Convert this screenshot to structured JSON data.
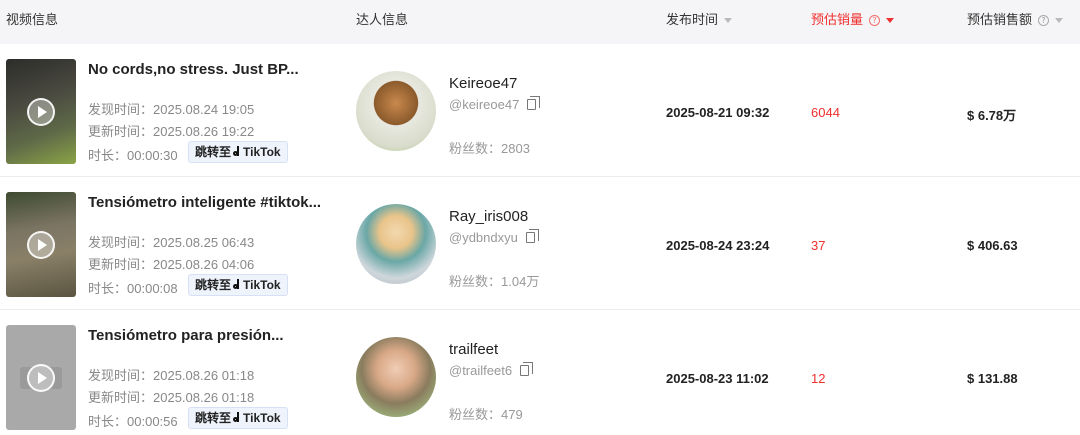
{
  "header": {
    "video_info": "视频信息",
    "influencer_info": "达人信息",
    "publish_time": "发布时间",
    "est_sales": "预估销量",
    "est_revenue": "预估销售额",
    "help_glyph": "?"
  },
  "labels": {
    "discovered": "发现时间：",
    "updated": "更新时间：",
    "duration": "时长：",
    "jump_to": "跳转至",
    "tiktok": "TikTok",
    "fans": "粉丝数："
  },
  "rows": [
    {
      "title": "No cords,no stress. Just BP...",
      "discovered": "2025.08.24 19:05",
      "updated": "2025.08.26 19:22",
      "duration": "00:00:30",
      "name": "Keireoe47",
      "handle": "@keireoe47",
      "fans": "2803",
      "publish_time": "2025-08-21 09:32",
      "sales": "6044",
      "amount": "$ 6.78万"
    },
    {
      "title": "Tensiómetro inteligente #tiktok...",
      "discovered": "2025.08.25 06:43",
      "updated": "2025.08.26 04:06",
      "duration": "00:00:08",
      "name": "Ray_iris008",
      "handle": "@ydbndxyu",
      "fans": "1.04万",
      "publish_time": "2025-08-24 23:24",
      "sales": "37",
      "amount": "$ 406.63"
    },
    {
      "title": "Tensiómetro para presión...",
      "discovered": "2025.08.26 01:18",
      "updated": "2025.08.26 01:18",
      "duration": "00:00:56",
      "name": "trailfeet",
      "handle": "@trailfeet6",
      "fans": "479",
      "publish_time": "2025-08-23 11:02",
      "sales": "12",
      "amount": "$ 131.88"
    }
  ],
  "colors": {
    "accent_red": "#f02f2f",
    "header_bg": "#f5f5f7",
    "tiktok_btn_bg": "#eef3fc"
  }
}
